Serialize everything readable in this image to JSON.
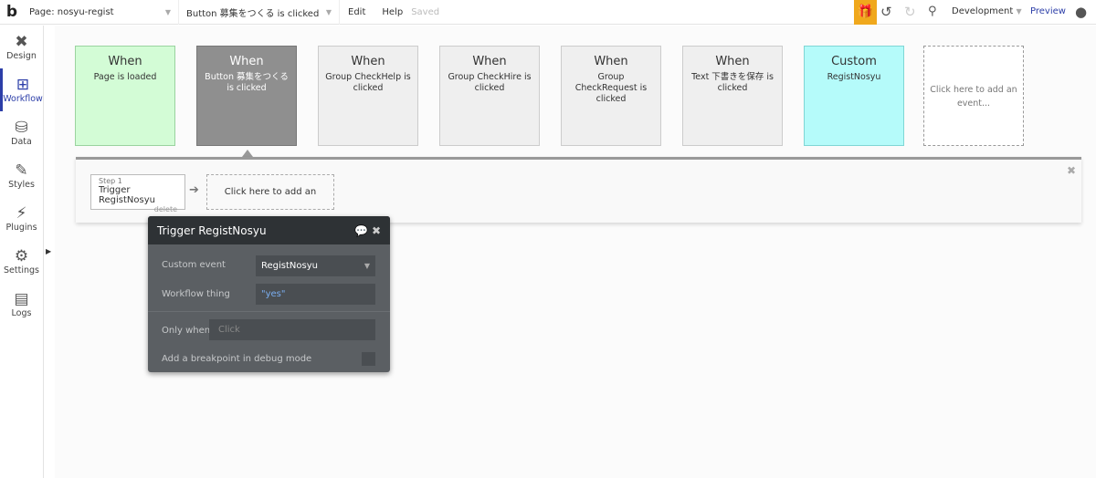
{
  "topbar": {
    "logo": "b",
    "page": "Page: nosyu-regist",
    "event": "Button 募集をつくる is clicked",
    "edit": "Edit",
    "help": "Help",
    "saved": "Saved",
    "gift_icon": "gift-icon",
    "environment": "Development",
    "preview": "Preview"
  },
  "sidebar": {
    "items": [
      {
        "label": "Design",
        "icon": "✖"
      },
      {
        "label": "Workflow",
        "icon": "⊞"
      },
      {
        "label": "Data",
        "icon": "⛁"
      },
      {
        "label": "Styles",
        "icon": "✎"
      },
      {
        "label": "Plugins",
        "icon": "⚡"
      },
      {
        "label": "Settings",
        "icon": "⚙"
      },
      {
        "label": "Logs",
        "icon": "▤"
      }
    ]
  },
  "events": [
    {
      "title": "When",
      "desc": "Page is loaded",
      "bg": "#d3fcd6",
      "border": "#9ad39f",
      "color": "#333"
    },
    {
      "title": "When",
      "desc": "Button 募集をつくる is clicked",
      "bg": "#8f8f8f",
      "border": "#777",
      "color": "#fff"
    },
    {
      "title": "When",
      "desc": "Group CheckHelp is clicked",
      "bg": "#efefef",
      "border": "#ccc",
      "color": "#333"
    },
    {
      "title": "When",
      "desc": "Group CheckHire is clicked",
      "bg": "#efefef",
      "border": "#ccc",
      "color": "#333"
    },
    {
      "title": "When",
      "desc": "Group CheckRequest is clicked",
      "bg": "#efefef",
      "border": "#ccc",
      "color": "#333"
    },
    {
      "title": "When",
      "desc": "Text 下書きを保存 is clicked",
      "bg": "#efefef",
      "border": "#ccc",
      "color": "#333"
    },
    {
      "title": "Custom",
      "desc": "RegistNosyu",
      "bg": "#b5fbfa",
      "border": "#7fd6d5",
      "color": "#333"
    }
  ],
  "add_event": "Click here to add an event...",
  "step": {
    "label": "Step 1",
    "name": "Trigger RegistNosyu",
    "delete": "delete"
  },
  "add_action": "Click here to add an action...",
  "popup": {
    "title": "Trigger RegistNosyu",
    "custom_event_label": "Custom event",
    "custom_event_value": "RegistNosyu",
    "thing_label": "Workflow thing",
    "thing_value": "\"yes\"",
    "only_when_label": "Only when",
    "only_when_placeholder": "Click",
    "breakpoint_label": "Add a breakpoint in debug mode"
  }
}
